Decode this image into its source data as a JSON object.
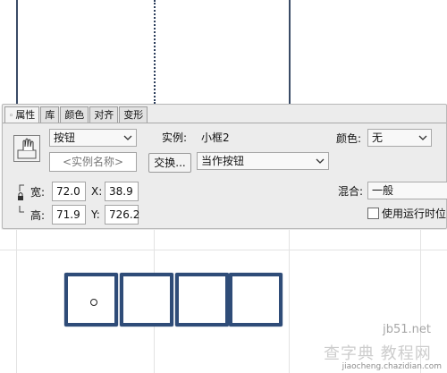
{
  "tabs": [
    {
      "label": "属性",
      "active": true
    },
    {
      "label": "库"
    },
    {
      "label": "颜色"
    },
    {
      "label": "对齐"
    },
    {
      "label": "变形"
    }
  ],
  "symbol": {
    "icon": "button-symbol-icon",
    "behavior_value": "按钮",
    "instance_label": "实例:",
    "instance_name": "小框2",
    "instance_name_placeholder": "<实例名称>",
    "swap_button": "交换...",
    "tracking_value": "当作按钮"
  },
  "color": {
    "label": "颜色:",
    "value": "无"
  },
  "blend": {
    "label": "混合:",
    "value": "一般"
  },
  "runtime_bitmap": {
    "label": "使用运行时位",
    "checked": false
  },
  "dimensions": {
    "width_label": "宽:",
    "width_value": "72.0",
    "height_label": "高:",
    "height_value": "71.9",
    "x_label": "X:",
    "x_value": "38.9",
    "y_label": "Y:",
    "y_value": "726.2"
  },
  "watermark": {
    "line1": "jb51.net",
    "line2": "查字典 教程网",
    "line3": "jiaocheng.chazidian.com"
  },
  "colors": {
    "cell_border": "#2f4c78",
    "panel_bg": "#ececec",
    "stage_line": "#3a4b66"
  }
}
